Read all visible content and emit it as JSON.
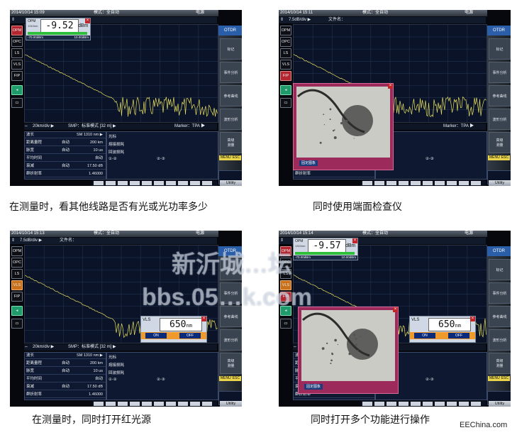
{
  "panels": [
    {
      "date": "2014/10/14 15:09",
      "mode": "模式：全自动",
      "battery": "电源",
      "sub_scale": "",
      "file_label": "",
      "left_buttons": [
        "OPM",
        "OPC",
        "LS",
        "VLS",
        "FIP"
      ],
      "left_button_states": [
        "red",
        "dark",
        "dark",
        "dark",
        "dark"
      ],
      "scale_row": {
        "dist": "20km/div ▶",
        "smp": "SMP：标准模式 [32 m] ▶",
        "marker": "Marker：TPA ▶"
      },
      "table": [
        {
          "k": "波长",
          "m": "",
          "v": "SM 1310 nm ▶"
        },
        {
          "k": "距离量程",
          "m": "自动",
          "v": "200 km"
        },
        {
          "k": "脉宽",
          "m": "自动",
          "v": "10 us"
        },
        {
          "k": "平均时间",
          "m": "",
          "v": "自动"
        },
        {
          "k": "衰减",
          "m": "自动",
          "v": "17.50 dB"
        },
        {
          "k": "群折射率",
          "m": "",
          "v": "1.46000"
        }
      ],
      "info": {
        "a": "光标",
        "b": "熔接损耗",
        "c": "回波损耗",
        "d": "①-②",
        "e": "②-③"
      },
      "sidebar": {
        "top": "OTDR",
        "items": [
          "标记",
          "事件分析",
          "参考曲线",
          "波形分析",
          "高级\n测量"
        ],
        "menu": "MENU",
        "esc": "ESC",
        "utility": "Utility"
      },
      "opm": {
        "show": true,
        "label": "OPM",
        "wl": "1310nm",
        "reading": "-9.52",
        "unit": "dBm",
        "lo": "-70.00dBm",
        "hi": "10.00dBm"
      },
      "vls": {
        "show": false
      },
      "scope": {
        "show": false
      }
    },
    {
      "date": "2014/10/14 15:11",
      "mode": "模式：全自动",
      "battery": "电源",
      "sub_scale": "7.5dB/div ▶",
      "file_label": "文件名：",
      "left_buttons": [
        "OPM",
        "OPC",
        "LS",
        "VLS",
        "FIP"
      ],
      "left_button_states": [
        "dark",
        "dark",
        "dark",
        "dark",
        "red"
      ],
      "scale_row": {
        "dist": "",
        "smp": "",
        "marker": "Marker：TPA ▶"
      },
      "table": [
        {
          "k": "波长",
          "m": "",
          "v": ""
        },
        {
          "k": "距离量程",
          "m": "",
          "v": ""
        },
        {
          "k": "脉宽",
          "m": "",
          "v": ""
        },
        {
          "k": "平均时间",
          "m": "",
          "v": ""
        },
        {
          "k": "衰减",
          "m": "",
          "v": ""
        },
        {
          "k": "群折射率",
          "m": "",
          "v": ""
        }
      ],
      "info": {
        "a": "",
        "b": "",
        "c": "",
        "d": "",
        "e": "②-③"
      },
      "sidebar": {
        "top": "OTDR",
        "items": [
          "标记",
          "事件分析",
          "参考曲线",
          "波形分析",
          "高级\n测量"
        ],
        "menu": "MENU",
        "esc": "ESC",
        "utility": "Utility"
      },
      "opm": {
        "show": false
      },
      "vls": {
        "show": false
      },
      "scope": {
        "show": true,
        "label": "固定图象"
      }
    },
    {
      "date": "2014/10/14 15:13",
      "mode": "模式：全自动",
      "battery": "电源",
      "sub_scale": "7.5dB/div ▶",
      "file_label": "文件名：",
      "left_buttons": [
        "OPM",
        "OPC",
        "LS",
        "VLS",
        "FIP"
      ],
      "left_button_states": [
        "dark",
        "dark",
        "dark",
        "orange",
        "dark"
      ],
      "scale_row": {
        "dist": "20km/div ▶",
        "smp": "SMP：标准模式 [32 m] ▶",
        "marker": ""
      },
      "table": [
        {
          "k": "波长",
          "m": "",
          "v": "SM 1310 nm ▶"
        },
        {
          "k": "距离量程",
          "m": "自动",
          "v": "200 km"
        },
        {
          "k": "脉宽",
          "m": "自动",
          "v": "10 us"
        },
        {
          "k": "平均时间",
          "m": "",
          "v": "自动"
        },
        {
          "k": "衰减",
          "m": "自动",
          "v": "17.50 dB"
        },
        {
          "k": "群折射率",
          "m": "",
          "v": "1.46000"
        }
      ],
      "info": {
        "a": "光标",
        "b": "熔接损耗",
        "c": "回波损耗",
        "d": "①-②",
        "e": "②-③"
      },
      "sidebar": {
        "top": "OTDR",
        "items": [
          "标记",
          "事件分析",
          "参考曲线",
          "波形分析",
          "高级\n测量"
        ],
        "menu": "MENU",
        "esc": "ESC",
        "utility": "Utility"
      },
      "opm": {
        "show": false
      },
      "vls": {
        "show": true,
        "label": "VLS",
        "reading": "650",
        "unit": "nm",
        "on": "ON",
        "off": "OFF"
      },
      "scope": {
        "show": false
      }
    },
    {
      "date": "2014/10/14 15:14",
      "mode": "模式：全自动",
      "battery": "电源",
      "sub_scale": "",
      "file_label": "",
      "left_buttons": [
        "OPM",
        "OPC",
        "LS",
        "VLS",
        "FIP"
      ],
      "left_button_states": [
        "red",
        "dark",
        "dark",
        "orange",
        "red"
      ],
      "scale_row": {
        "dist": "",
        "smp": "",
        "marker": ""
      },
      "table": [
        {
          "k": "波长",
          "m": "",
          "v": ""
        },
        {
          "k": "距离量程",
          "m": "",
          "v": ""
        },
        {
          "k": "脉宽",
          "m": "",
          "v": ""
        },
        {
          "k": "平均时间",
          "m": "",
          "v": ""
        },
        {
          "k": "衰减",
          "m": "",
          "v": ""
        },
        {
          "k": "群折射率",
          "m": "",
          "v": ""
        }
      ],
      "info": {
        "a": "",
        "b": "",
        "c": "",
        "d": "",
        "e": "②-③"
      },
      "sidebar": {
        "top": "OTDR",
        "items": [
          "标记",
          "事件分析",
          "参考曲线",
          "波形分析",
          "高级\n测量"
        ],
        "menu": "MENU",
        "esc": "ESC",
        "utility": "Utility"
      },
      "opm": {
        "show": true,
        "label": "OPM",
        "wl": "1310nm",
        "reading": "-9.57",
        "unit": "dBm",
        "lo": "-70.00dBm",
        "hi": "10.00dBm"
      },
      "vls": {
        "show": true,
        "label": "VLS",
        "reading": "650",
        "unit": "nm",
        "on": "ON",
        "off": "OFF"
      },
      "scope": {
        "show": true,
        "label": "固定图象"
      }
    }
  ],
  "captions": [
    "在测量时，看其他线路是否有光或光功率多少",
    "同时使用端面检查仪",
    "在测量时，同时打开红光源",
    "同时打开多个功能进行操作"
  ],
  "watermark": {
    "line1": "新沂城…坛",
    "line2": "bbs.05…k.com"
  },
  "footer": "EEChina.com",
  "colors": {
    "trace": "#e8e060",
    "graph_bg": "#0a1328",
    "accent": "#2a5ea8"
  }
}
